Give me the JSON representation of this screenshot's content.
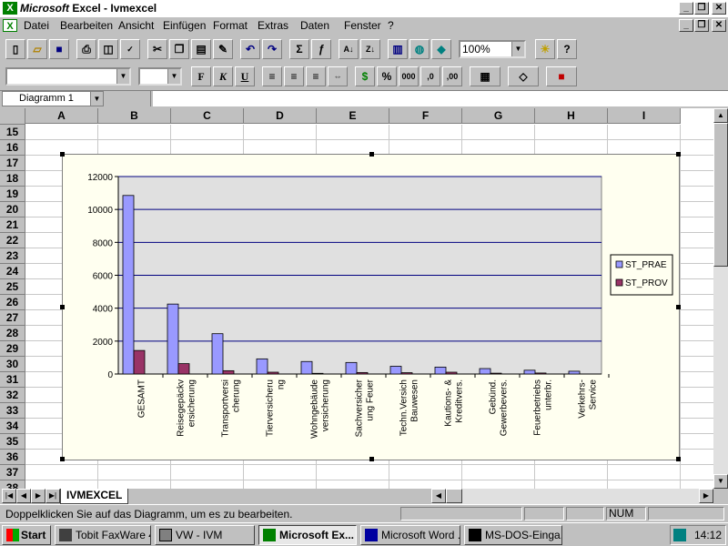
{
  "window": {
    "title_app": "Microsoft",
    "title_rest": "Excel - Ivmexcel",
    "minimize": "_",
    "restore": "❐",
    "close": "✕"
  },
  "menu": [
    "Datei",
    "Bearbeiten",
    "Ansicht",
    "Einfügen",
    "Format",
    "Extras",
    "Daten",
    "Fenster",
    "?"
  ],
  "toolbar": {
    "zoom": "100%",
    "font_name": "",
    "font_size": "",
    "bold": "F",
    "italic": "K",
    "underline": "U",
    "percent": "%",
    "thousands": "000",
    "dec_inc": ",0",
    "dec_dec": ",00"
  },
  "namebox": {
    "value": "Diagramm 1"
  },
  "columns": [
    "A",
    "B",
    "C",
    "D",
    "E",
    "F",
    "G",
    "H",
    "I"
  ],
  "rows": [
    "15",
    "16",
    "17",
    "18",
    "19",
    "20",
    "21",
    "22",
    "23",
    "24",
    "25",
    "26",
    "27",
    "28",
    "29",
    "30",
    "31",
    "32",
    "33",
    "34",
    "35",
    "36",
    "37",
    "38"
  ],
  "chart_data": {
    "type": "bar",
    "title": "",
    "categories": [
      "GESAMT",
      "Reisegepäckv ersicherung",
      "Transportversi cherung",
      "Tierversicheru ng",
      "Wohngebäude versicherung",
      "Sachversicher ung Feuer",
      "Techn.Versich Bauwesen",
      "Kautions- & Kreditvers.",
      "Gebünd. Gewerbevers.",
      "Feuerbetriebs unterbr.",
      "Verkehrs- Service"
    ],
    "category_lines": [
      [
        "GESAMT"
      ],
      [
        "Reisegepäckv",
        "ersicherung"
      ],
      [
        "Transportversi",
        "cherung"
      ],
      [
        "Tierversicheru",
        "ng"
      ],
      [
        "Wohngebäude",
        "versicherung"
      ],
      [
        "Sachversicher",
        "ung Feuer"
      ],
      [
        "Techn.Versich",
        "Bauwesen"
      ],
      [
        "Kautions- &",
        "Kreditvers."
      ],
      [
        "Gebünd.",
        "Gewerbevers."
      ],
      [
        "Feuerbetriebs",
        "unterbr."
      ],
      [
        "Verkehrs-",
        "Service"
      ]
    ],
    "series": [
      {
        "name": "ST_PRAE",
        "color": "#9999ff",
        "values": [
          10850,
          4250,
          2450,
          920,
          760,
          700,
          470,
          420,
          330,
          230,
          170
        ]
      },
      {
        "name": "ST_PROV",
        "color": "#993366",
        "values": [
          1430,
          630,
          200,
          110,
          40,
          90,
          80,
          110,
          50,
          60,
          0
        ]
      }
    ],
    "ylim": [
      0,
      12000
    ],
    "yticks": [
      "0",
      "2000",
      "4000",
      "6000",
      "8000",
      "10000",
      "12000"
    ],
    "plot_bg": "#e0e0e0",
    "grid": true,
    "legend": "right"
  },
  "sheet_tab": "IVMEXCEL",
  "status": {
    "message": "Doppelklicken Sie auf das Diagramm, um es zu bearbeiten.",
    "num": "NUM"
  },
  "taskbar": {
    "start": "Start",
    "tasks": [
      "Tobit FaxWare 4",
      "VW - IVM",
      "Microsoft Ex...",
      "Microsoft Word ...",
      "MS-DOS-Einga..."
    ],
    "clock": "14:12"
  }
}
